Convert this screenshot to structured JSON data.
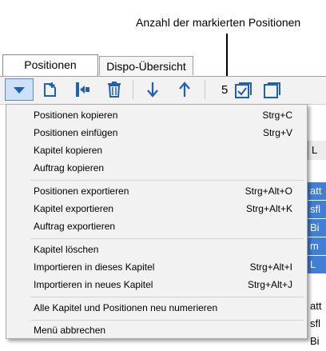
{
  "annotation": {
    "label": "Anzahl der markierten Positionen"
  },
  "tabs": [
    {
      "label": "Positionen"
    },
    {
      "label": "Dispo-Übersicht"
    }
  ],
  "toolbar": {
    "selected_count": "5",
    "icons": [
      "dropdown-arrow-icon",
      "insert-icon",
      "tree-move-icon",
      "trash-icon",
      "arrow-down-icon",
      "arrow-up-icon",
      "checkbox-checked-icon",
      "checkbox-empty-icon"
    ],
    "accent_color": "#1f5fb4"
  },
  "menu": {
    "items": [
      {
        "label": "Positionen kopieren",
        "shortcut": "Strg+C"
      },
      {
        "label": "Positionen einfügen",
        "shortcut": "Strg+V"
      },
      {
        "label": "Kapitel kopieren",
        "shortcut": ""
      },
      {
        "label": "Auftrag kopieren",
        "shortcut": ""
      },
      {
        "label": "Positionen exportieren",
        "shortcut": "Strg+Alt+O"
      },
      {
        "label": "Kapitel exportieren",
        "shortcut": "Strg+Alt+K"
      },
      {
        "label": "Auftrag exportieren",
        "shortcut": ""
      },
      {
        "label": "Kapitel löschen",
        "shortcut": ""
      },
      {
        "label": "Importieren in dieses Kapitel",
        "shortcut": "Strg+Alt+I"
      },
      {
        "label": "Importieren in neues Kapitel",
        "shortcut": "Strg+Alt+J"
      },
      {
        "label": "Alle Kapitel und Positionen neu numerieren",
        "shortcut": ""
      },
      {
        "label": "Menü abbrechen",
        "shortcut": ""
      }
    ]
  },
  "background": {
    "header_fragment": "L",
    "rows": [
      "att",
      "sfl",
      "Bi",
      "m",
      "L",
      "att",
      "sfl",
      "Bi"
    ]
  }
}
